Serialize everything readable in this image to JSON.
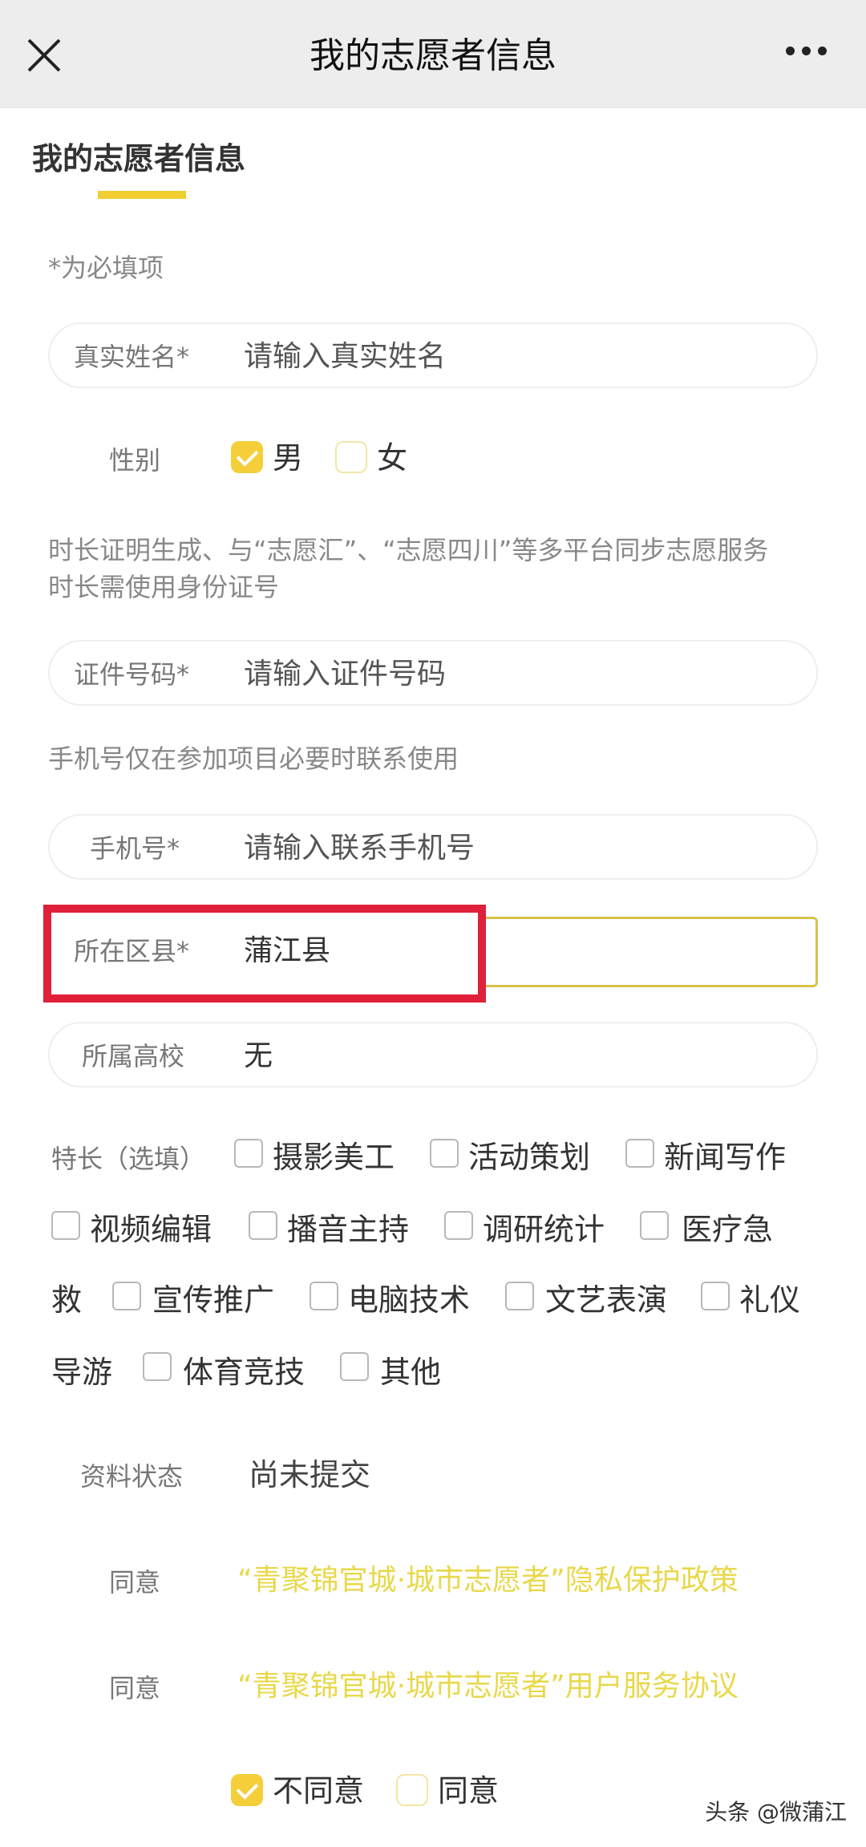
{
  "nav": {
    "title": "我的志愿者信息"
  },
  "section": {
    "title": "我的志愿者信息"
  },
  "hints": {
    "required": "*为必填项",
    "id_notice_line1": "时长证明生成、与“志愿汇”、“志愿四川”等多平台同步志愿服务",
    "id_notice_line2": "时长需使用身份证号",
    "phone_notice": "手机号仅在参加项目必要时联系使用"
  },
  "fields": {
    "name": {
      "label": "真实姓名*",
      "placeholder": "请输入真实姓名"
    },
    "gender": {
      "label": "性别",
      "options": [
        "男",
        "女"
      ],
      "selected": "男"
    },
    "id_number": {
      "label": "证件号码*",
      "placeholder": "请输入证件号码"
    },
    "phone": {
      "label": "手机号*",
      "placeholder": "请输入联系手机号"
    },
    "district": {
      "label": "所在区县*",
      "value": "蒲江县"
    },
    "school": {
      "label": "所属高校",
      "value": "无"
    }
  },
  "skills": {
    "label": "特长（选填）",
    "items": [
      "摄影美工",
      "活动策划",
      "新闻写作",
      "视频编辑",
      "播音主持",
      "调研统计",
      "医疗急",
      "救",
      "宣传推广",
      "电脑技术",
      "文艺表演",
      "礼仪",
      "导游",
      "体育竞技",
      "其他"
    ]
  },
  "status": {
    "label": "资料状态",
    "value": "尚未提交"
  },
  "agreements": {
    "privacy": {
      "label": "同意",
      "text": "“青聚锦官城·城市志愿者”隐私保护政策"
    },
    "service": {
      "label": "同意",
      "text": "“青聚锦官城·城市志愿者”用户服务协议"
    },
    "choices": [
      "不同意",
      "同意"
    ],
    "selected": "不同意"
  },
  "watermark": "头条 @微蒲江",
  "colors": {
    "accent": "#f4cf3a",
    "highlight": "#e0203a",
    "link": "#e8d84a"
  }
}
